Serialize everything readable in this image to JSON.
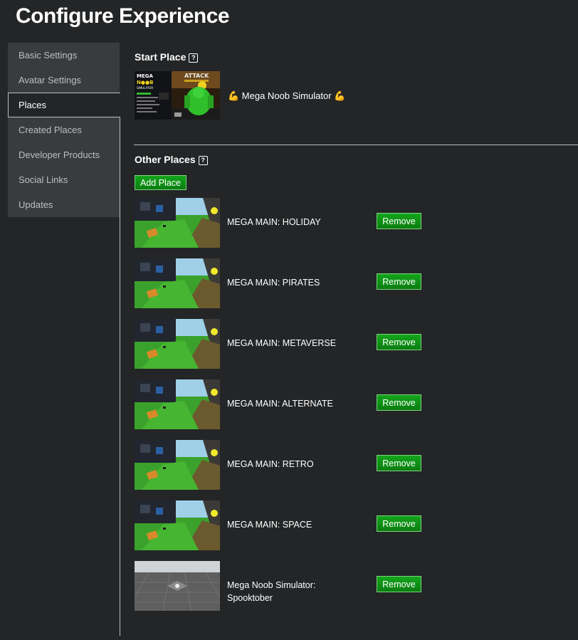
{
  "page": {
    "title": "Configure Experience"
  },
  "sidebar": {
    "items": [
      {
        "label": "Basic Settings"
      },
      {
        "label": "Avatar Settings"
      },
      {
        "label": "Places",
        "active": true
      },
      {
        "label": "Created Places"
      },
      {
        "label": "Developer Products"
      },
      {
        "label": "Social Links"
      },
      {
        "label": "Updates"
      }
    ]
  },
  "start_place": {
    "title": "Start Place",
    "help_icon": "question-icon",
    "name": "💪 Mega Noob Simulator 💪",
    "thumbnail_text": {
      "brand_top": "MEGA",
      "brand_mid": "N●●B",
      "brand_bottom": "SIMULATOR",
      "banner": "ATTACK"
    }
  },
  "other_places": {
    "title": "Other Places",
    "help_icon": "question-icon",
    "add_label": "Add Place",
    "remove_label": "Remove",
    "items": [
      {
        "name": "MEGA MAIN: HOLIDAY",
        "thumb": "green"
      },
      {
        "name": "MEGA MAIN: PIRATES",
        "thumb": "green"
      },
      {
        "name": "MEGA MAIN: METAVERSE",
        "thumb": "green"
      },
      {
        "name": "MEGA MAIN: ALTERNATE",
        "thumb": "green"
      },
      {
        "name": "MEGA MAIN: RETRO",
        "thumb": "green"
      },
      {
        "name": "MEGA MAIN: SPACE",
        "thumb": "green"
      },
      {
        "name": "Mega Noob Simulator: Spooktober",
        "thumb": "gray"
      }
    ]
  },
  "colors": {
    "background": "#232527",
    "sidebar": "#393b3d",
    "button_green": "#0f8f16",
    "divider": "#bdbebe"
  }
}
